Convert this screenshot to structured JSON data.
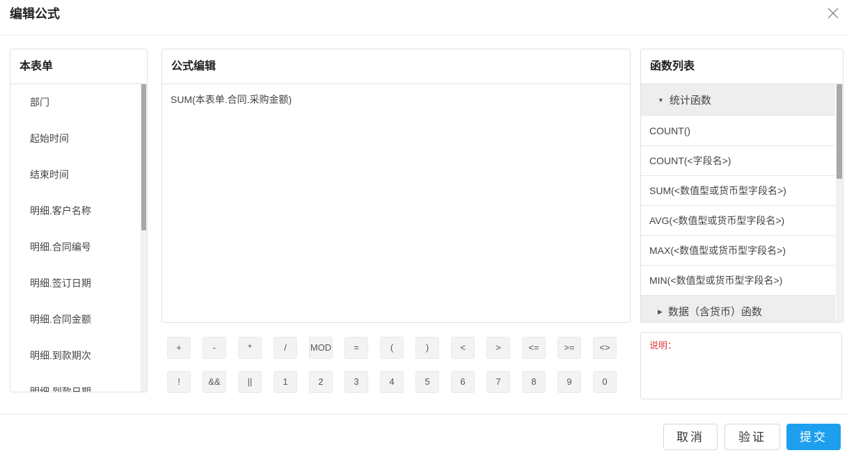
{
  "dialog": {
    "title": "编辑公式"
  },
  "left_panel": {
    "title": "本表单",
    "fields": [
      "部门",
      "起始时间",
      "结束时间",
      "明细.客户名称",
      "明细.合同编号",
      "明细.签订日期",
      "明细.合同金额",
      "明细.到款期次",
      "明细.到款日期"
    ]
  },
  "middle_panel": {
    "title": "公式编辑",
    "formula": "SUM(本表单.合同.采购金额)"
  },
  "keypad": {
    "row1": [
      "+",
      "-",
      "*",
      "/",
      "MOD",
      "=",
      "(",
      ")",
      "<",
      ">",
      "<=",
      ">=",
      "<>"
    ],
    "row2": [
      "!",
      "&&",
      "||",
      "1",
      "2",
      "3",
      "4",
      "5",
      "6",
      "7",
      "8",
      "9",
      "0"
    ]
  },
  "right_panel": {
    "title": "函数列表",
    "group1": "统计函数",
    "functions": [
      "COUNT()",
      "COUNT(<字段名>)",
      "SUM(<数值型或货币型字段名>)",
      "AVG(<数值型或货币型字段名>)",
      "MAX(<数值型或货币型字段名>)",
      "MIN(<数值型或货币型字段名>)"
    ],
    "group2": "数据（含货币）函数"
  },
  "description": {
    "label": "说明："
  },
  "footer": {
    "cancel": "取消",
    "verify": "验证",
    "submit": "提交"
  },
  "colors": {
    "primary": "#1e9fee",
    "description_text": "#e4393c"
  },
  "icons": {
    "close": "close-icon",
    "expanded": "triangle-down-icon",
    "collapsed": "triangle-right-icon"
  }
}
